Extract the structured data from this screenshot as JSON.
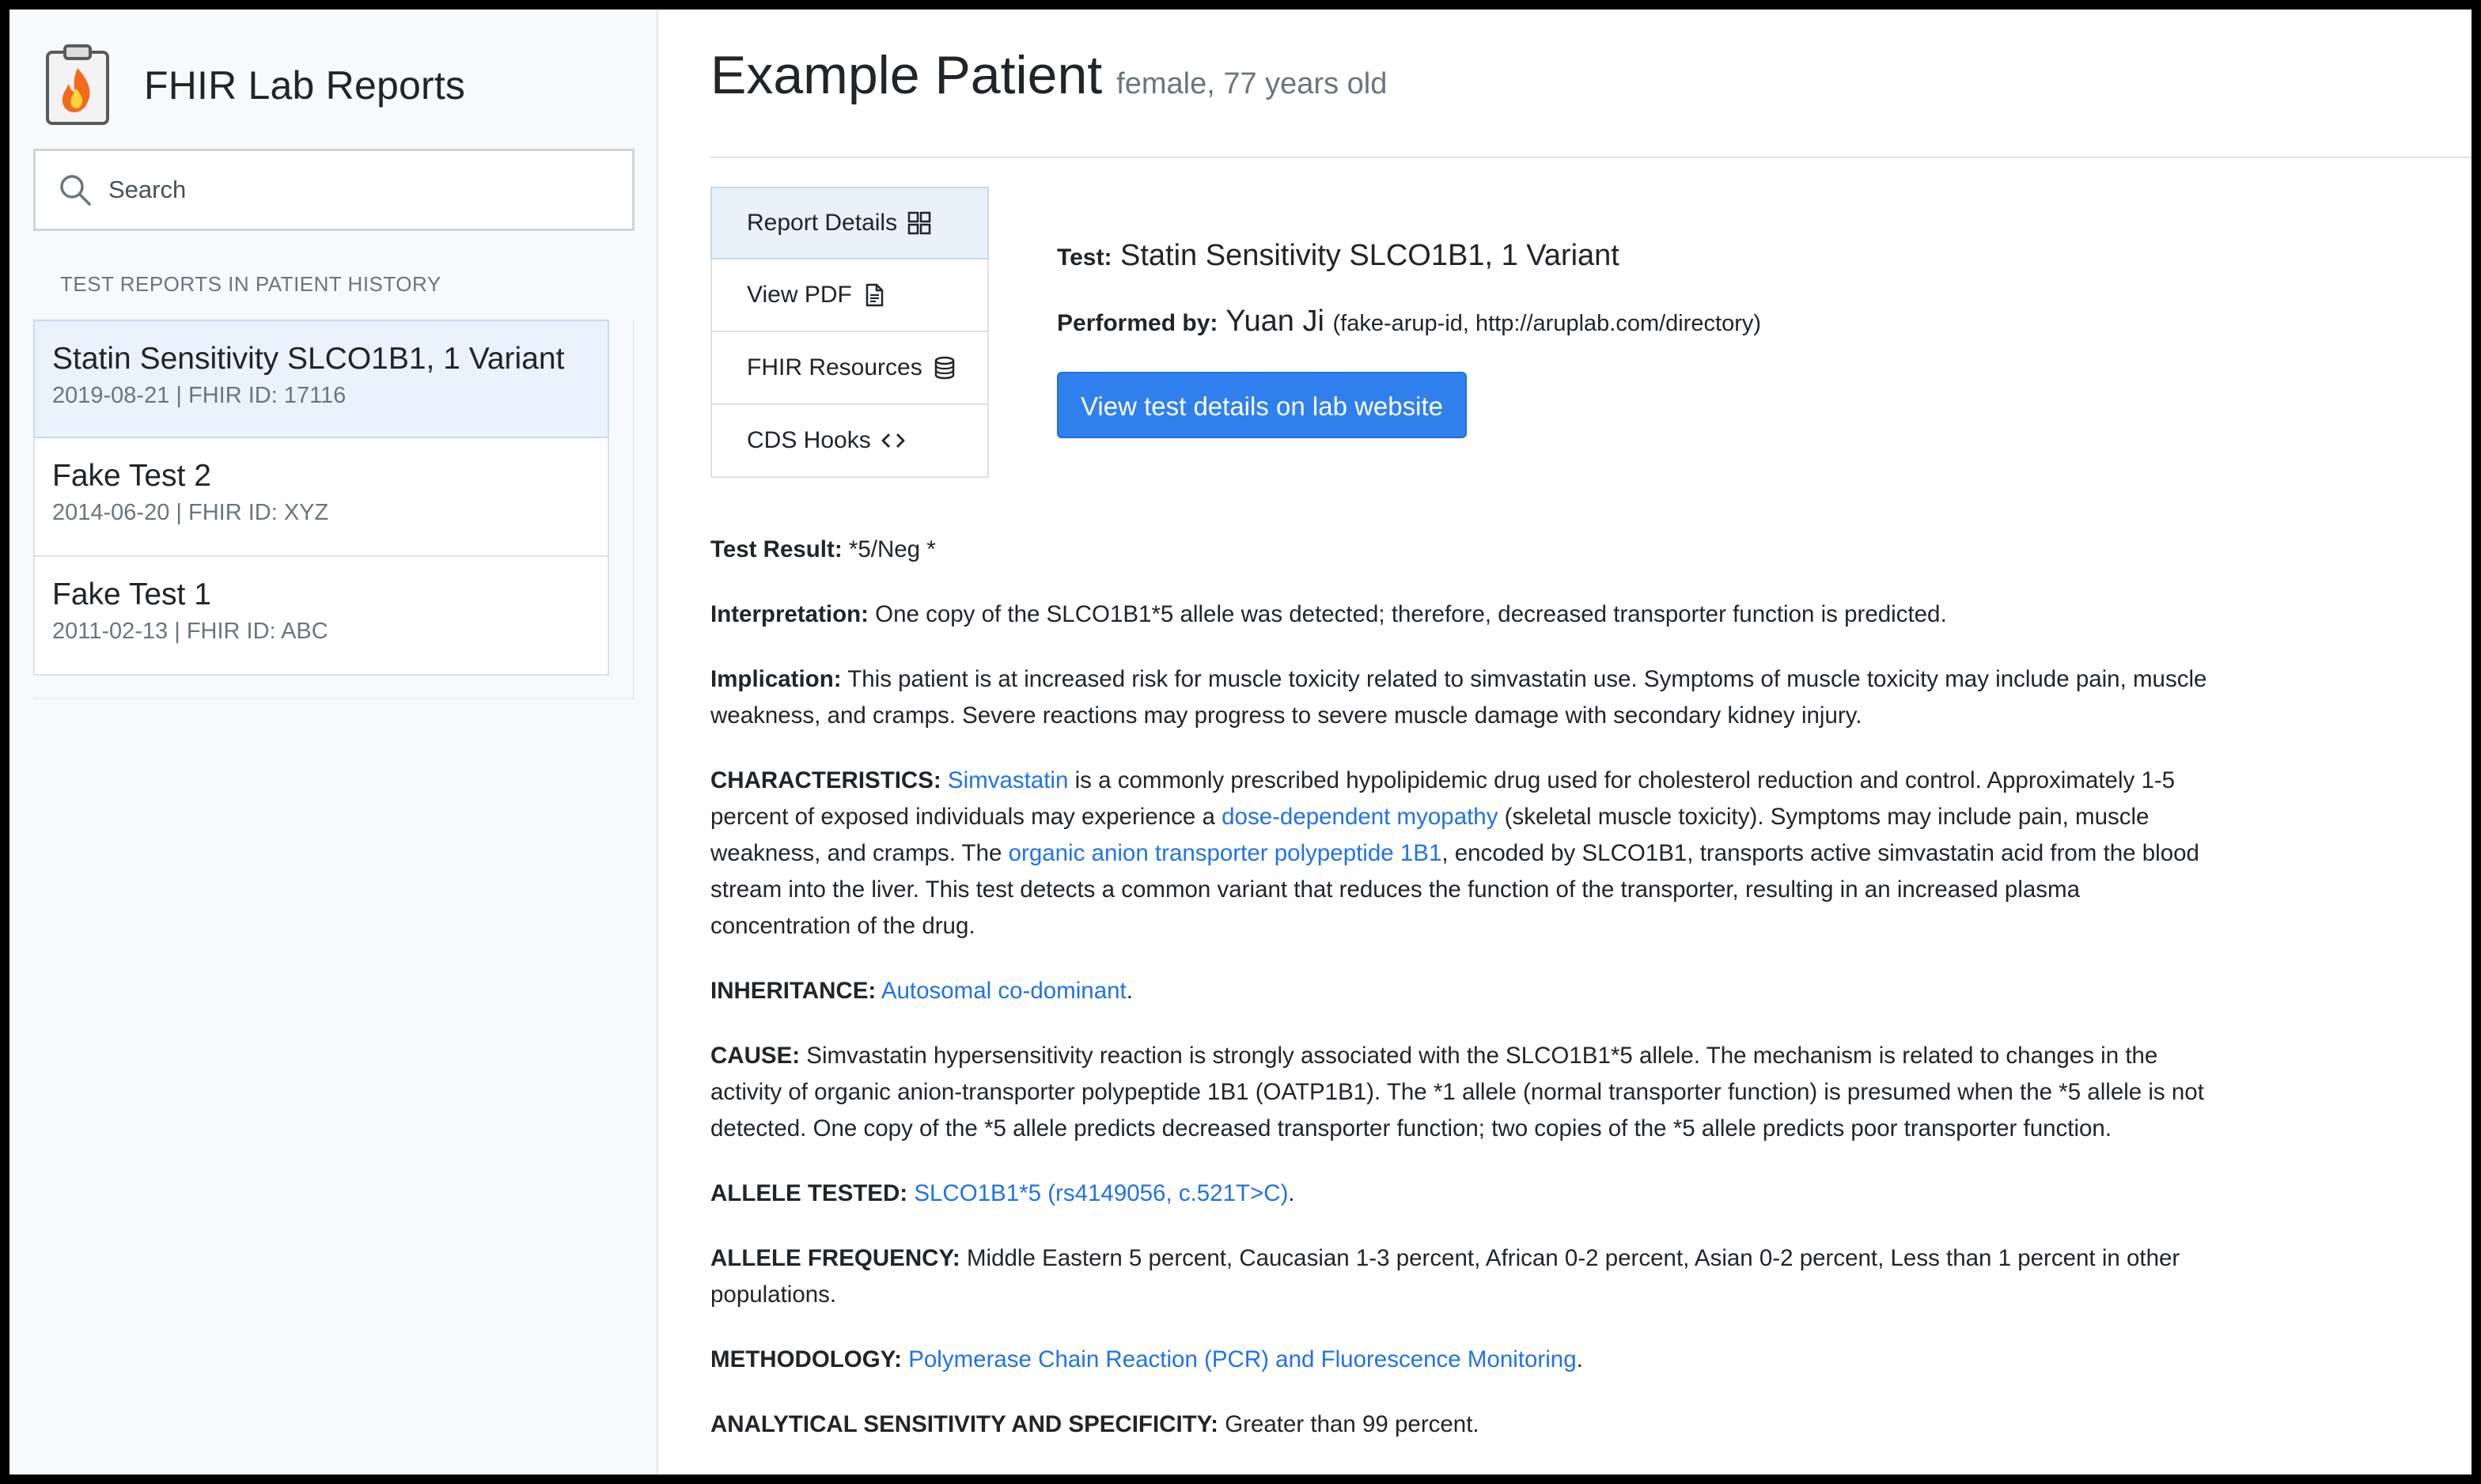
{
  "app": {
    "title": "FHIR Lab Reports"
  },
  "search": {
    "placeholder": "Search"
  },
  "sidebar": {
    "heading": "TEST REPORTS IN PATIENT HISTORY",
    "reports": [
      {
        "name": "Statin Sensitivity SLCO1B1, 1 Variant",
        "meta": "2019-08-21 | FHIR ID: 17116",
        "active": true
      },
      {
        "name": "Fake Test 2",
        "meta": "2014-06-20 | FHIR ID: XYZ",
        "active": false
      },
      {
        "name": "Fake Test 1",
        "meta": "2011-02-13 | FHIR ID: ABC",
        "active": false
      }
    ]
  },
  "patient": {
    "name": "Example Patient",
    "info": "female, 77 years old"
  },
  "tabs": [
    {
      "label": "Report Details",
      "icon": "grid-icon"
    },
    {
      "label": "View PDF",
      "icon": "document-icon"
    },
    {
      "label": "FHIR Resources",
      "icon": "database-icon"
    },
    {
      "label": "CDS Hooks",
      "icon": "code-icon"
    }
  ],
  "summary": {
    "test_label": "Test:",
    "test_value": "Statin Sensitivity SLCO1B1, 1 Variant",
    "performer_label": "Performed by:",
    "performer_name": "Yuan Ji",
    "performer_detail": "(fake-arup-id, http://aruplab.com/directory)",
    "button_label": "View test details on lab website"
  },
  "details": {
    "result": {
      "label": "Test Result:",
      "text": "*5/Neg *"
    },
    "interpretation": {
      "label": "Interpretation:",
      "text": "One copy of the SLCO1B1*5 allele was detected; therefore, decreased transporter function is predicted."
    },
    "implication": {
      "label": "Implication:",
      "text": "This patient is at increased risk for muscle toxicity related to simvastatin use. Symptoms of muscle toxicity may include pain, muscle weakness, and cramps. Severe reactions may progress to severe muscle damage with secondary kidney injury."
    },
    "characteristics": {
      "label": "CHARACTERISTICS:",
      "link1": "Simvastatin",
      "text1": "is a commonly prescribed hypolipidemic drug used for cholesterol reduction and control. Approximately 1-5 percent of exposed individuals may experience a",
      "link2": "dose-dependent myopathy",
      "text2": "(skeletal muscle toxicity). Symptoms may include pain, muscle weakness, and cramps. The",
      "link3": "organic anion transporter polypeptide 1B1",
      "text3": ", encoded by SLCO1B1, transports active simvastatin acid from the blood stream into the liver. This test detects a common variant that reduces the function of the transporter, resulting in an increased plasma concentration of the drug."
    },
    "inheritance": {
      "label": "INHERITANCE:",
      "link": "Autosomal co-dominant",
      "after": "."
    },
    "cause": {
      "label": "CAUSE:",
      "text": "Simvastatin hypersensitivity reaction is strongly associated with the SLCO1B1*5 allele. The mechanism is related to changes in the activity of organic anion-transporter polypeptide 1B1 (OATP1B1). The *1 allele (normal transporter function) is presumed when the *5 allele is not detected. One copy of the *5 allele predicts decreased transporter function; two copies of the *5 allele predicts poor transporter function."
    },
    "allele_tested": {
      "label": "ALLELE TESTED:",
      "link": "SLCO1B1*5 (rs4149056, c.521T>C)",
      "after": "."
    },
    "allele_frequency": {
      "label": "ALLELE FREQUENCY:",
      "text": "Middle Eastern 5 percent, Caucasian 1-3 percent, African 0-2 percent, Asian 0-2 percent, Less than 1 percent in other populations."
    },
    "methodology": {
      "label": "METHODOLOGY:",
      "link": "Polymerase Chain Reaction (PCR) and Fluorescence Monitoring",
      "after": "."
    },
    "sensitivity": {
      "label": "ANALYTICAL SENSITIVITY AND SPECIFICITY:",
      "text": "Greater than 99 percent."
    }
  },
  "colors": {
    "accent": "#2f80ed",
    "link": "#1f73e6",
    "active_bg": "#eaf2fd",
    "sidebar_bg": "#f8f9fa"
  }
}
